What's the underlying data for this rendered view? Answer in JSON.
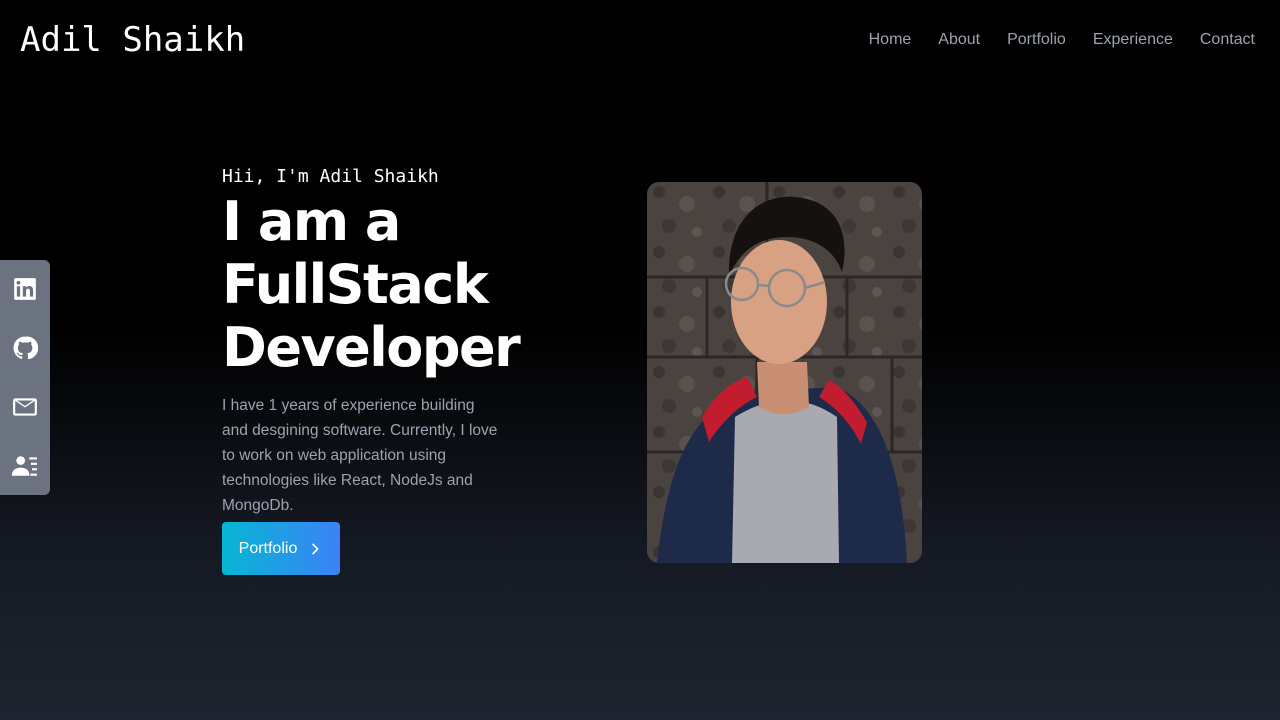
{
  "navbar": {
    "logo": "Adil Shaikh",
    "links": [
      {
        "label": "Home"
      },
      {
        "label": "About"
      },
      {
        "label": "Portfolio"
      },
      {
        "label": "Experience"
      },
      {
        "label": "Contact"
      }
    ]
  },
  "social": [
    {
      "icon": "linkedin-icon"
    },
    {
      "icon": "github-icon"
    },
    {
      "icon": "mail-icon"
    },
    {
      "icon": "resume-icon"
    }
  ],
  "hero": {
    "greeting": "Hii, I'm Adil Shaikh",
    "headline_lines": [
      "I am a",
      "FullStack",
      "Developer"
    ],
    "description": "I have 1 years of experience building and desgining software. Currently, I love to work on web application using technologies like React, NodeJs and MongoDb.",
    "button_label": "Portfolio"
  },
  "colors": {
    "background_top": "#000000",
    "background_bottom": "#1f2530",
    "nav_link": "#9ca3af",
    "social_bar": "#6b7280",
    "button_gradient_start": "#06b6d4",
    "button_gradient_end": "#3b82f6"
  }
}
